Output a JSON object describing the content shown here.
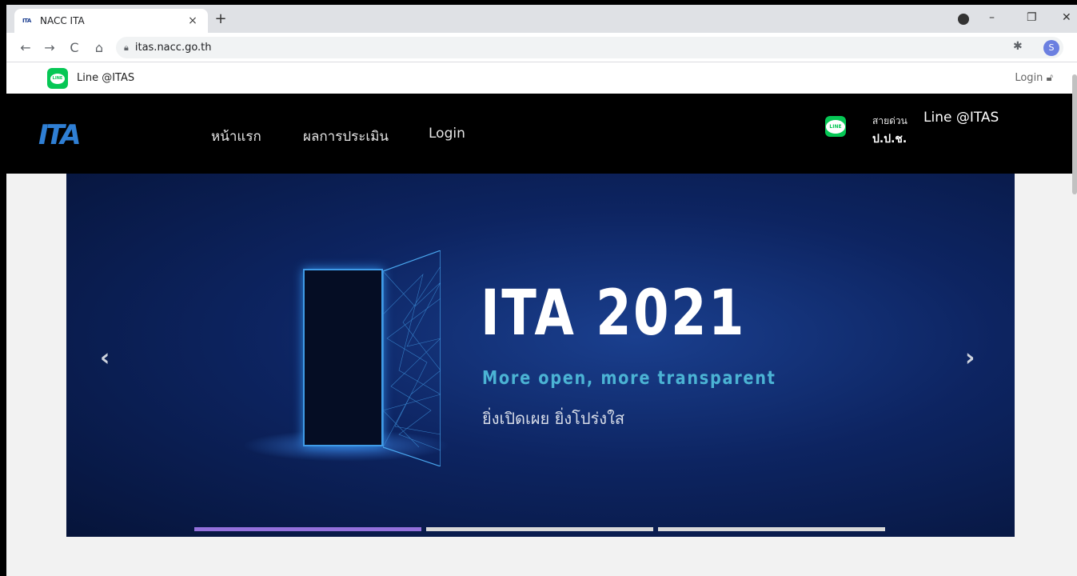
{
  "browser": {
    "tab": {
      "favicon_text": "ITA",
      "title": "NACC ITA",
      "close_glyph": "×"
    },
    "new_tab_glyph": "+",
    "window_controls": {
      "minimize": "–",
      "restore": "❐",
      "close": "✕"
    },
    "nav": {
      "back": "←",
      "forward": "→",
      "reload": "C",
      "home": "⌂"
    },
    "url": "itas.nacc.go.th",
    "star_glyph": "☆",
    "profile_initial": "S",
    "menu_glyph": "⋮"
  },
  "topbar": {
    "line_label": "Line @ITAS",
    "login_label": "Login",
    "login_icon": "lock-icon"
  },
  "navbar": {
    "logo_text": "ITA",
    "links": [
      "หน้าแรก",
      "ผลการประเมิน",
      "Login"
    ],
    "hotline_label": "สายด่วน",
    "hotline_line": "Line @ITAS",
    "hotline_org": "ป.ป.ช."
  },
  "carousel": {
    "title": "ITA 2021",
    "subtitle": "More open, more transparent",
    "thai_tagline": "ยิ่งเปิดเผย ยิ่งโปร่งใส",
    "prev_glyph": "‹",
    "next_glyph": "›",
    "active_slide": 1,
    "slide_count": 3
  },
  "colors": {
    "line_green": "#06c755",
    "nav_bg": "#000000",
    "banner_bg": "#0d2461",
    "subtitle": "#4bb3d4",
    "indicator_active": "#9370db"
  }
}
